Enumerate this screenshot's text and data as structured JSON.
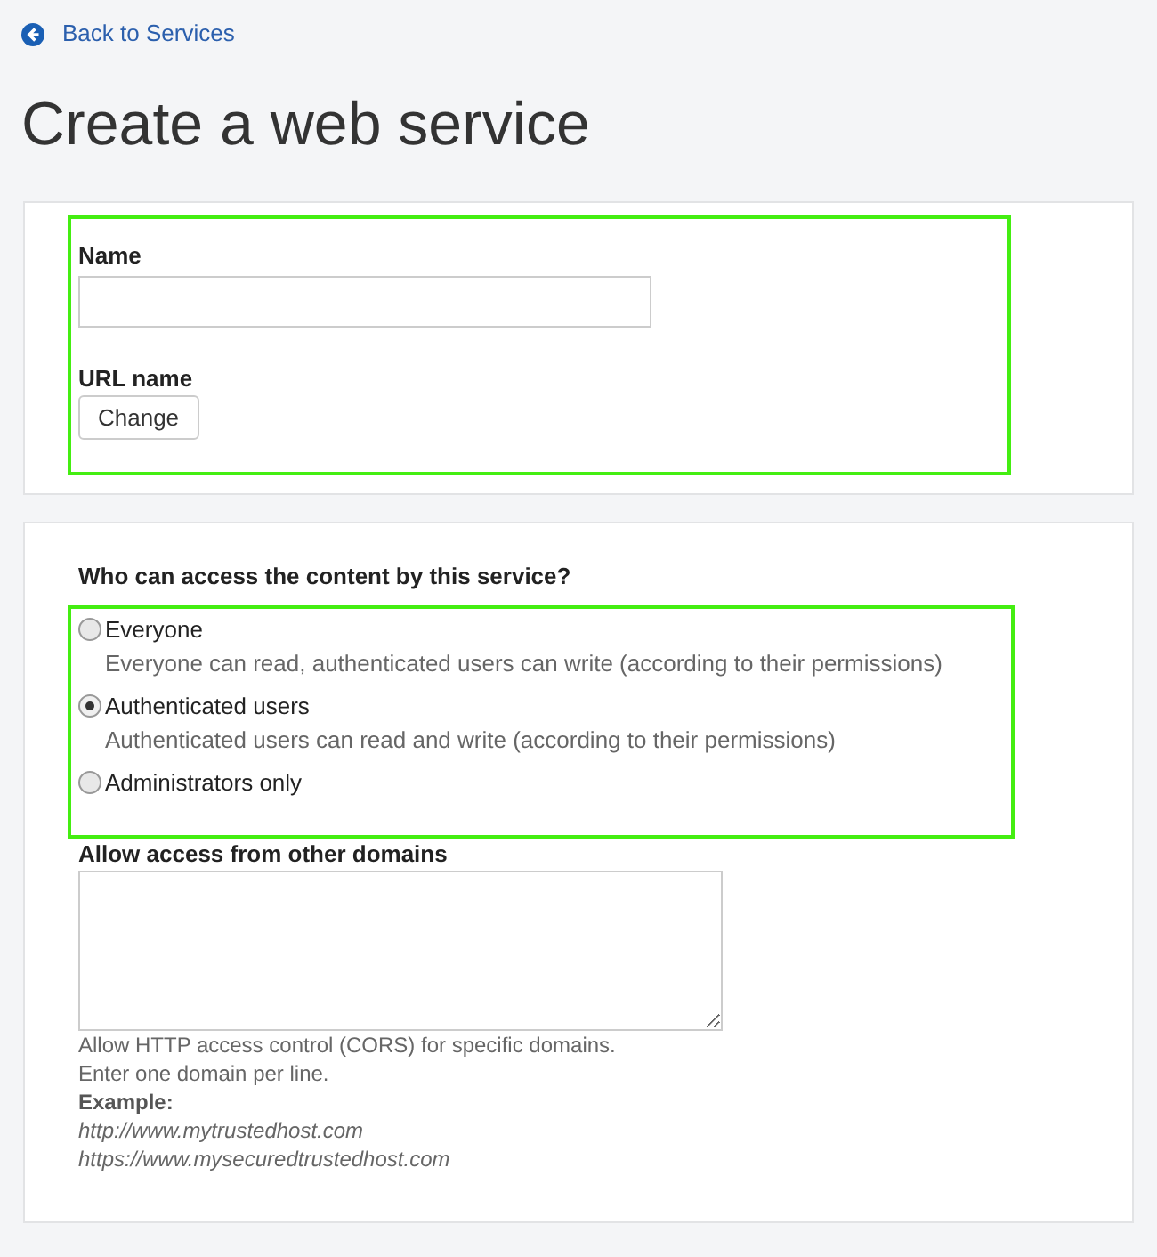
{
  "back_link": "Back to Services",
  "title": "Create a web service",
  "name_field": {
    "label": "Name"
  },
  "url_name": {
    "label": "URL name",
    "button": "Change"
  },
  "access": {
    "question": "Who can access the content by this service?",
    "options": [
      {
        "label": "Everyone",
        "description": "Everyone can read, authenticated users can write (according to their permissions)",
        "selected": false
      },
      {
        "label": "Authenticated users",
        "description": "Authenticated users can read and write (according to their permissions)",
        "selected": true
      },
      {
        "label": "Administrators only",
        "selected": false
      }
    ]
  },
  "domains": {
    "label": "Allow access from other domains",
    "hints": [
      "Allow HTTP access control (CORS) for specific domains.",
      "Enter one domain per line."
    ],
    "example_label": "Example:",
    "examples": [
      "http://www.mytrustedhost.com",
      "https://www.mysecuredtrustedhost.com"
    ]
  }
}
